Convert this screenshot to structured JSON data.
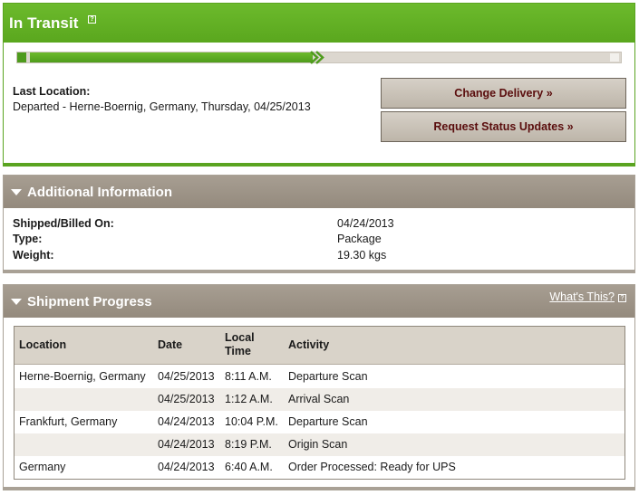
{
  "status": {
    "title": "In Transit",
    "help_icon": "?",
    "progress": 0.49,
    "last_location_label": "Last Location:",
    "last_location_value": "Departed - Herne-Boernig, Germany, Thursday, 04/25/2013",
    "buttons": {
      "change_delivery": "Change Delivery »",
      "request_updates": "Request Status Updates »"
    }
  },
  "additional_info": {
    "title": "Additional Information",
    "rows": [
      {
        "label": "Shipped/Billed On:",
        "value": "04/24/2013"
      },
      {
        "label": "Type:",
        "value": "Package"
      },
      {
        "label": "Weight:",
        "value": "19.30 kgs"
      }
    ]
  },
  "shipment_progress": {
    "title": "Shipment Progress",
    "whats_this": "What's This?",
    "help_icon": "?",
    "columns": {
      "location": "Location",
      "date": "Date",
      "time_line1": "Local",
      "time_line2": "Time",
      "activity": "Activity"
    },
    "rows": [
      {
        "location": "Herne-Boernig, Germany",
        "date": "04/25/2013",
        "time": "8:11 A.M.",
        "activity": "Departure Scan"
      },
      {
        "location": "",
        "date": "04/25/2013",
        "time": "1:12 A.M.",
        "activity": "Arrival Scan"
      },
      {
        "location": "Frankfurt, Germany",
        "date": "04/24/2013",
        "time": "10:04 P.M.",
        "activity": "Departure Scan"
      },
      {
        "location": "",
        "date": "04/24/2013",
        "time": "8:19 P.M.",
        "activity": "Origin Scan"
      },
      {
        "location": "Germany",
        "date": "04/24/2013",
        "time": "6:40 A.M.",
        "activity": "Order Processed: Ready for UPS"
      }
    ]
  },
  "colors": {
    "accent_green": "#5aa71e",
    "panel_brown": "#948a7d",
    "button_text": "#5a0d0d"
  }
}
